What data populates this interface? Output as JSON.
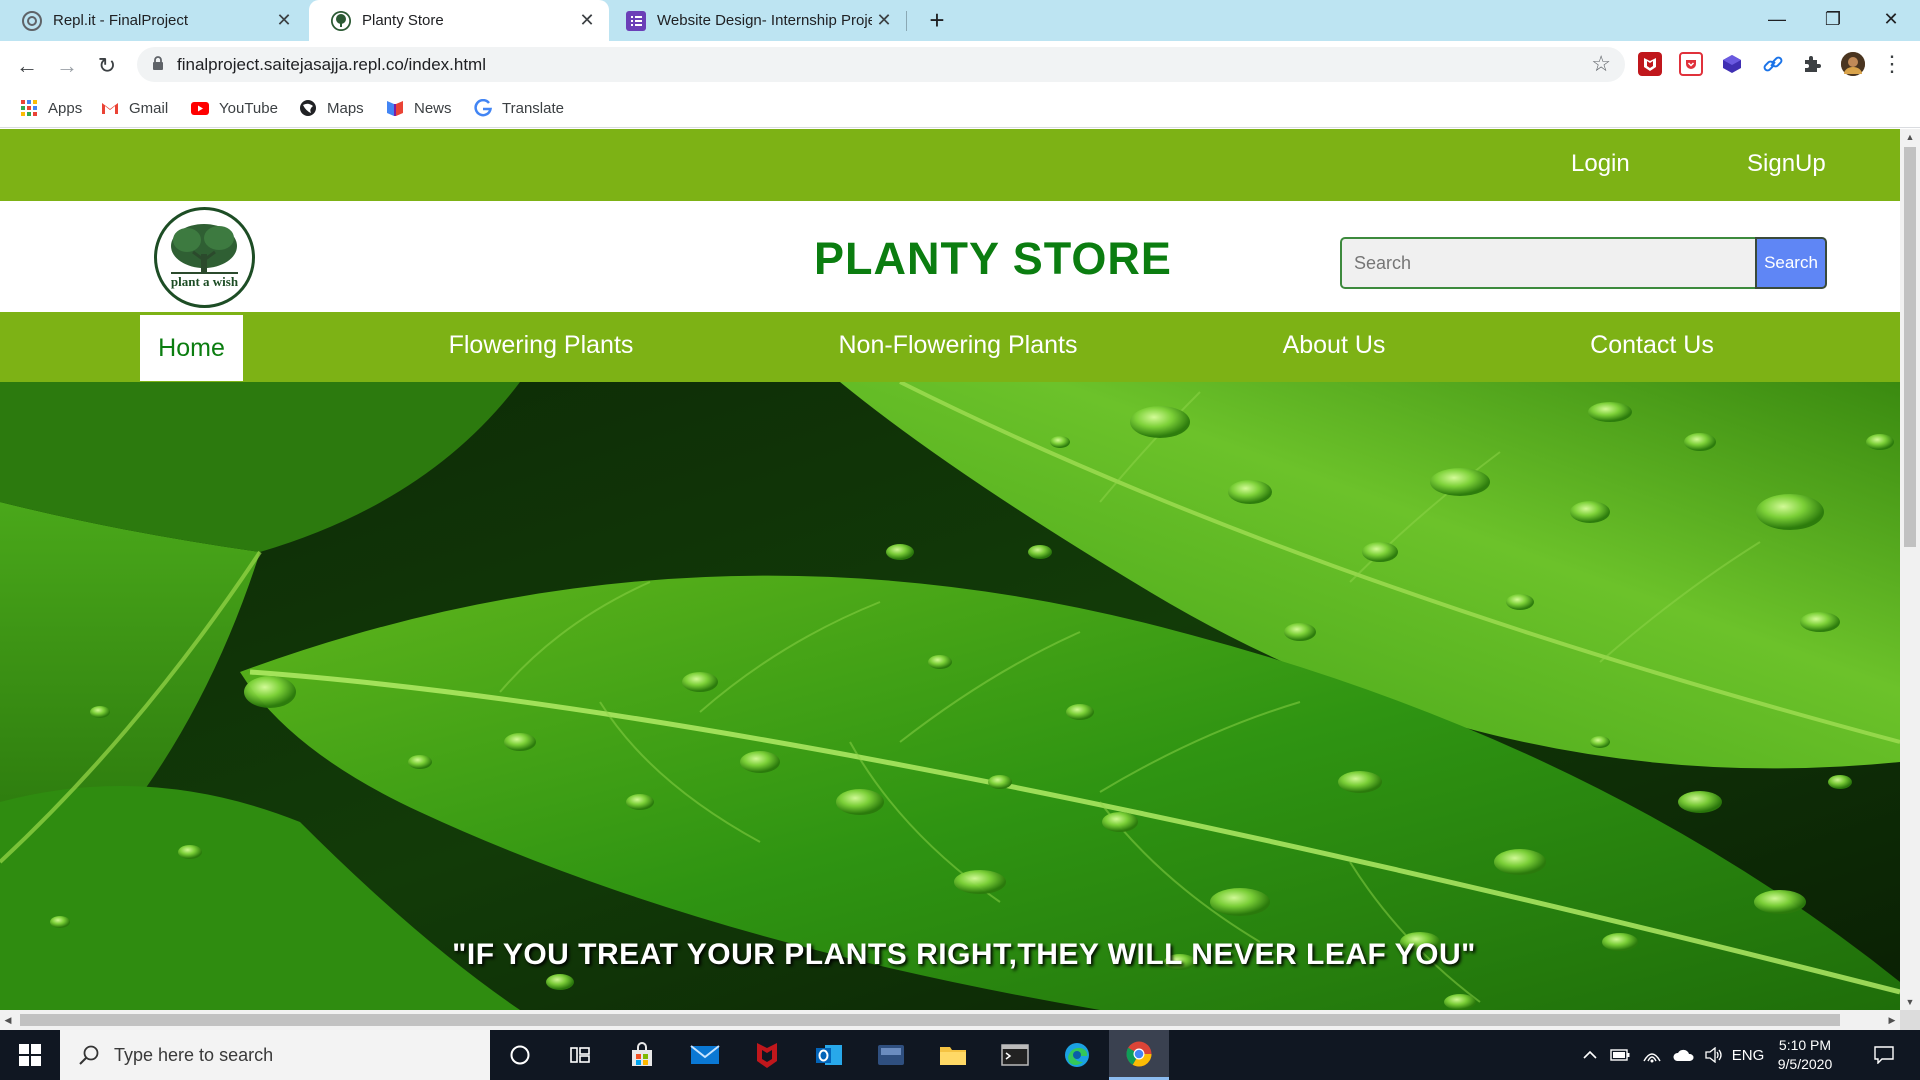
{
  "browser": {
    "tabs": [
      {
        "title": "Repl.it - FinalProject",
        "close": "✕"
      },
      {
        "title": "Planty Store",
        "close": "✕"
      },
      {
        "title": "Website Design- Internship Proje",
        "close": "✕"
      }
    ],
    "new_tab": "+",
    "window_controls": {
      "minimize": "—",
      "maximize": "❐",
      "close": "✕"
    },
    "nav": {
      "back": "←",
      "forward": "→",
      "reload": "↻"
    },
    "url": "finalproject.saitejasajja.repl.co/index.html",
    "star": "☆",
    "bookmarks": [
      {
        "label": "Apps",
        "icon": "apps-grid-icon"
      },
      {
        "label": "Gmail",
        "icon": "gmail-icon"
      },
      {
        "label": "YouTube",
        "icon": "youtube-icon"
      },
      {
        "label": "Maps",
        "icon": "maps-icon"
      },
      {
        "label": "News",
        "icon": "news-icon"
      },
      {
        "label": "Translate",
        "icon": "translate-icon"
      }
    ],
    "extension_icons": [
      "mcafee-icon",
      "pocket-icon",
      "extension-cube-icon",
      "link-icon",
      "puzzle-icon",
      "profile-avatar-icon"
    ],
    "menu": "⋮"
  },
  "site": {
    "top_links": {
      "login": "Login",
      "signup": "SignUp"
    },
    "logo_text": "plant a wish",
    "title": "PLANTY STORE",
    "search": {
      "placeholder": "Search",
      "button": "Search"
    },
    "nav": [
      "Home",
      "Flowering Plants",
      "Non-Flowering Plants",
      "About Us",
      "Contact Us"
    ],
    "active_nav": "Home",
    "quote": "\"IF YOU TREAT YOUR PLANTS RIGHT,THEY WILL NEVER LEAF YOU\""
  },
  "taskbar": {
    "search_placeholder": "Type here to search",
    "apps": [
      "cortana-icon",
      "task-view-icon",
      "store-icon",
      "mail-icon",
      "mcafee-icon",
      "outlook-icon",
      "app-icon",
      "file-explorer-icon",
      "terminal-icon",
      "edge-icon",
      "chrome-icon"
    ],
    "tray": {
      "language": "ENG"
    },
    "clock": {
      "time": "5:10 PM",
      "date": "9/5/2020"
    }
  },
  "colors": {
    "brand_green": "#7db215",
    "title_green": "#0b7d10",
    "search_button": "#5f86f5"
  }
}
